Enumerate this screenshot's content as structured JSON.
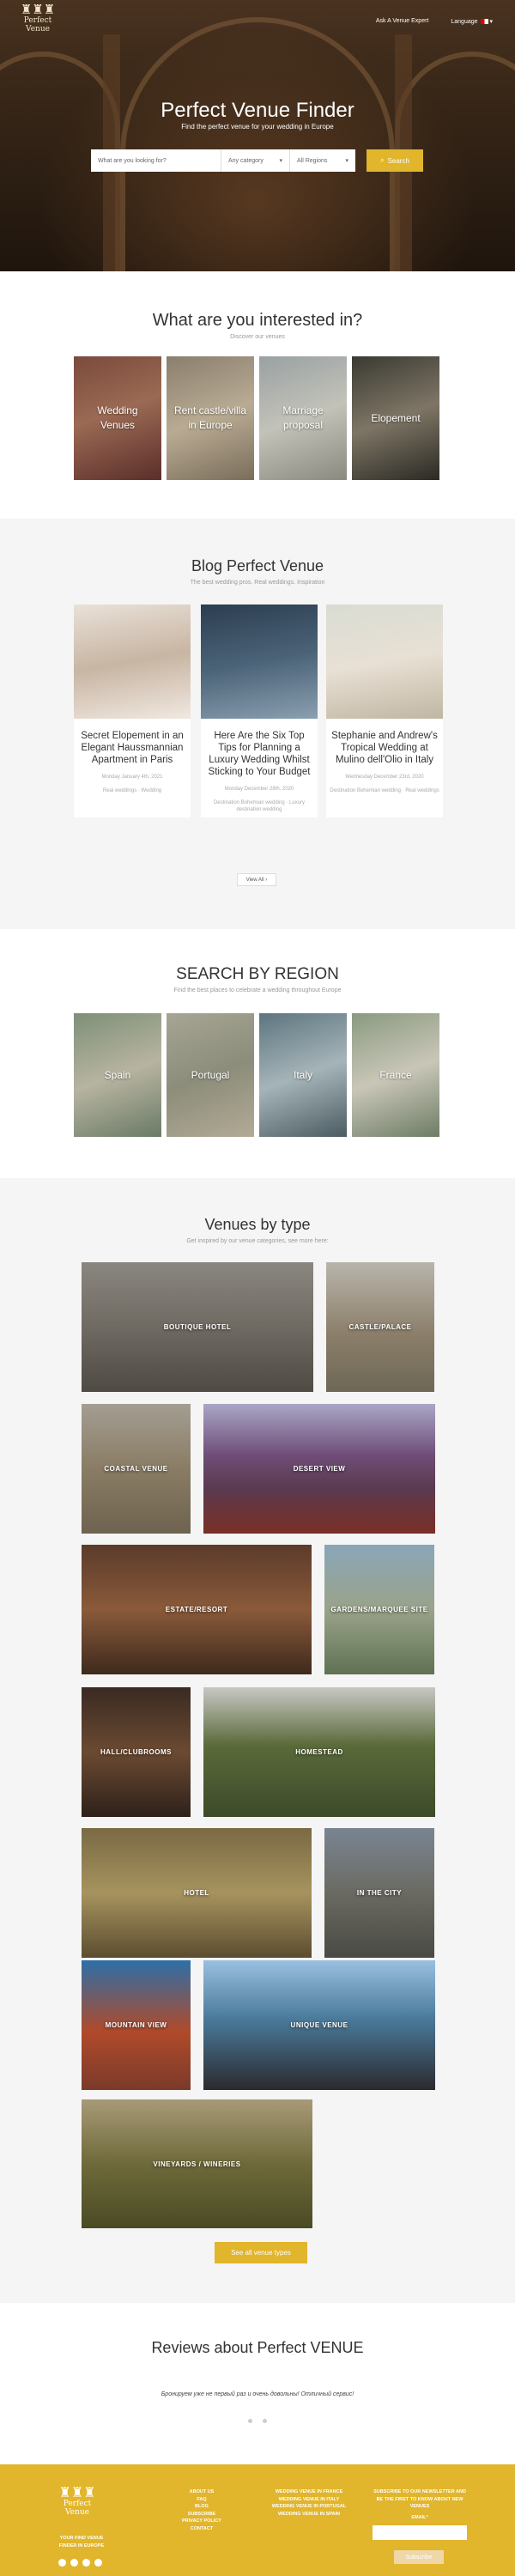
{
  "header": {
    "logo_text": "Perfect Venue",
    "nav": {
      "expert": "Ask A Venue Expert",
      "language": "Language"
    }
  },
  "hero": {
    "title": "Perfect Venue Finder",
    "subtitle": "Find the perfect venue for your wedding in Europe",
    "search": {
      "placeholder": "What are you looking for?",
      "category": "Any category",
      "region": "All Regions",
      "button": "Search"
    }
  },
  "interested": {
    "title": "What are you interested in?",
    "subtitle": "Discover our venues",
    "tiles": [
      {
        "label": "Wedding Venues"
      },
      {
        "label": "Rent castle/villa in Europe"
      },
      {
        "label": "Marriage proposal"
      },
      {
        "label": "Elopement"
      }
    ]
  },
  "blog": {
    "title": "Blog Perfect Venue",
    "subtitle": "The best wedding pros. Real weddings. Inspiration",
    "posts": [
      {
        "title": "Secret Elopement in an Elegant Haussmannian Apartment in Paris",
        "date": "Monday January 4th, 2021",
        "tags": "Real weddings · Wedding"
      },
      {
        "title": "Here Are the Six Top Tips for Planning a Luxury Wedding Whilst Sticking to Your Budget",
        "date": "Monday December 28th, 2020",
        "tags": "Destination Bohemian wedding · Luxury destination wedding"
      },
      {
        "title": "Stephanie and Andrew's Tropical Wedding at Mulino dell'Olio in Italy",
        "date": "Wednesday December 23rd, 2020",
        "tags": "Destination Bohemian wedding · Real weddings"
      }
    ],
    "view_all": "View All"
  },
  "region": {
    "title": "SEARCH BY REGION",
    "subtitle": "Find the best places to celebrate a wedding throughout Europe",
    "items": [
      {
        "label": "Spain"
      },
      {
        "label": "Portugal"
      },
      {
        "label": "Italy"
      },
      {
        "label": "France"
      }
    ]
  },
  "types": {
    "title": "Venues by type",
    "subtitle": "Get inspired by our venue categories, see more here:",
    "items": [
      {
        "label": "BOUTIQUE HOTEL"
      },
      {
        "label": "CASTLE/PALACE"
      },
      {
        "label": "COASTAL VENUE"
      },
      {
        "label": "DESERT VIEW"
      },
      {
        "label": "ESTATE/RESORT"
      },
      {
        "label": "GARDENS/MARQUEE SITE"
      },
      {
        "label": "HALL/CLUBROOMS"
      },
      {
        "label": "HOMESTEAD"
      },
      {
        "label": "HOTEL"
      },
      {
        "label": "IN THE CITY"
      },
      {
        "label": "MOUNTAIN VIEW"
      },
      {
        "label": "UNIQUE VENUE"
      },
      {
        "label": "VINEYARDS / WINERIES"
      }
    ],
    "see_all": "See all venue types"
  },
  "reviews": {
    "title": "Reviews about Perfect VENUE",
    "quote": "Бронируем уже не первый раз и очень довольны! Отличный сервис!"
  },
  "footer": {
    "logo_text": "Perfect Venue",
    "tagline": "YOUR FIND VENUE FINDER IN EUROPE",
    "links1": [
      "ABOUT US",
      "FAQ",
      "BLOG",
      "SUBSCRIBE",
      "PRIVACY POLICY",
      "CONTACT"
    ],
    "links2": [
      "WEDDING VENUE IN FRANCE",
      "WEDDING VENUE IN ITALY",
      "WEDDING VENUE IN PORTUGAL",
      "WEDDING VENUE IN SPAIN"
    ],
    "newsletter": "SUBSCRIBE TO OUR NEWSLETTER AND BE THE FIRST TO KNOW ABOUT NEW VENUES",
    "email_label": "EMAIL*",
    "subscribe": "Subscribe"
  }
}
